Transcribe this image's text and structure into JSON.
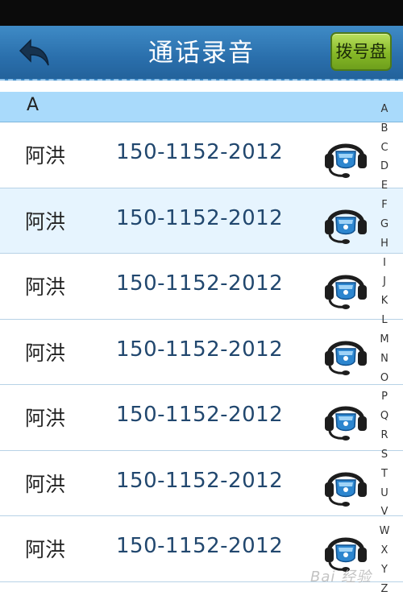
{
  "header": {
    "title": "通话录音",
    "dial_button": "拨号盘"
  },
  "section": {
    "letter": "A"
  },
  "contacts": [
    {
      "name": "阿洪",
      "phone": "150-1152-2012"
    },
    {
      "name": "阿洪",
      "phone": "150-1152-2012"
    },
    {
      "name": "阿洪",
      "phone": "150-1152-2012"
    },
    {
      "name": "阿洪",
      "phone": "150-1152-2012"
    },
    {
      "name": "阿洪",
      "phone": "150-1152-2012"
    },
    {
      "name": "阿洪",
      "phone": "150-1152-2012"
    },
    {
      "name": "阿洪",
      "phone": "150-1152-2012"
    }
  ],
  "alphabet": [
    "A",
    "B",
    "C",
    "D",
    "E",
    "F",
    "G",
    "H",
    "I",
    "J",
    "K",
    "L",
    "M",
    "N",
    "O",
    "P",
    "Q",
    "R",
    "S",
    "T",
    "U",
    "V",
    "W",
    "X",
    "Y",
    "Z"
  ],
  "watermark": "Bai 经验",
  "colors": {
    "header": "#2a6fac",
    "section": "#a9dafb",
    "alt_row": "#e6f4fe",
    "dial_button": "#86b827",
    "phone_text": "#21476e"
  },
  "icons": {
    "back": "back-arrow-icon",
    "recording": "headset-recording-icon"
  }
}
